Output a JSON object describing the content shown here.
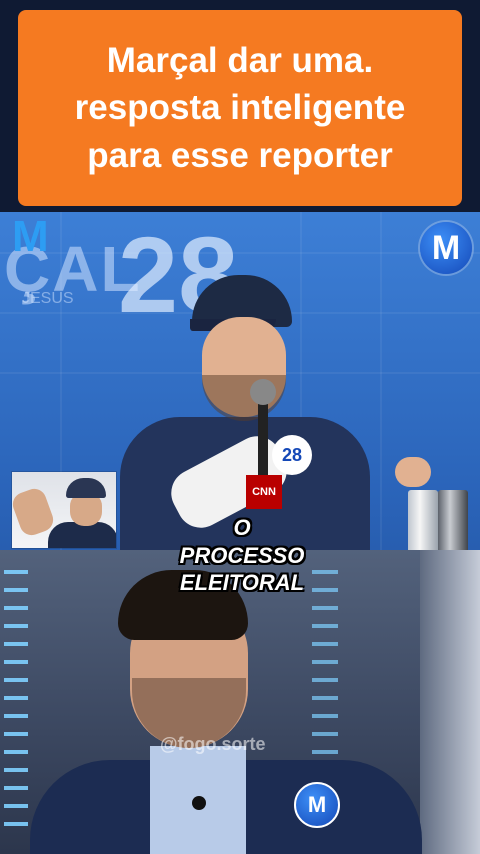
{
  "banner": {
    "title": "Marçal dar uma.\nresposta inteligente\npara esse reporter",
    "background": "#f57a21"
  },
  "video": {
    "backdrop_text_left": "ÇAL",
    "backdrop_text_sub": "JESUS",
    "backdrop_number": "28",
    "logo_left": "M",
    "logo_right": "M",
    "mic_flag": "CNN",
    "shirt_badge": "28",
    "caption": "O PROCESSO\nELEITORAL",
    "watermark": "@fogo.sorte",
    "lapel_pin": "M"
  }
}
